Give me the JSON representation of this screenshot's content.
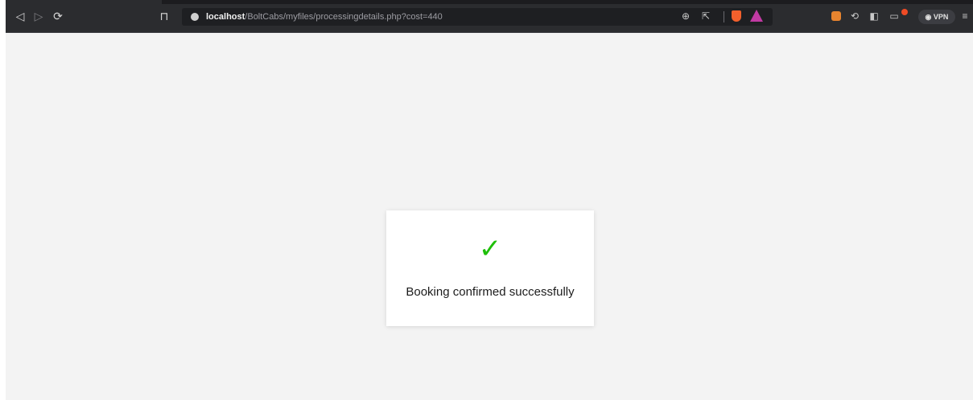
{
  "browser": {
    "url_host": "localhost",
    "url_path": "/BoltCabs/myfiles/processingdetails.php?cost=440",
    "vpn_label": "VPN",
    "nav_icons": {
      "back": "back-arrow-icon",
      "forward": "forward-arrow-icon",
      "reload": "reload-icon",
      "bookmark": "bookmark-icon"
    },
    "toolbar_icons": [
      "zoom-icon",
      "share-icon",
      "brave-shields-icon",
      "brave-rewards-icon",
      "metamask-icon",
      "extensions-icon",
      "sidebar-icon",
      "wallet-icon",
      "vpn-icon",
      "menu-icon"
    ]
  },
  "page": {
    "background": "#f3f3f3",
    "card": {
      "check_symbol": "✓",
      "check_color": "#1fbf0a",
      "message": "Booking confirmed successfully"
    }
  }
}
